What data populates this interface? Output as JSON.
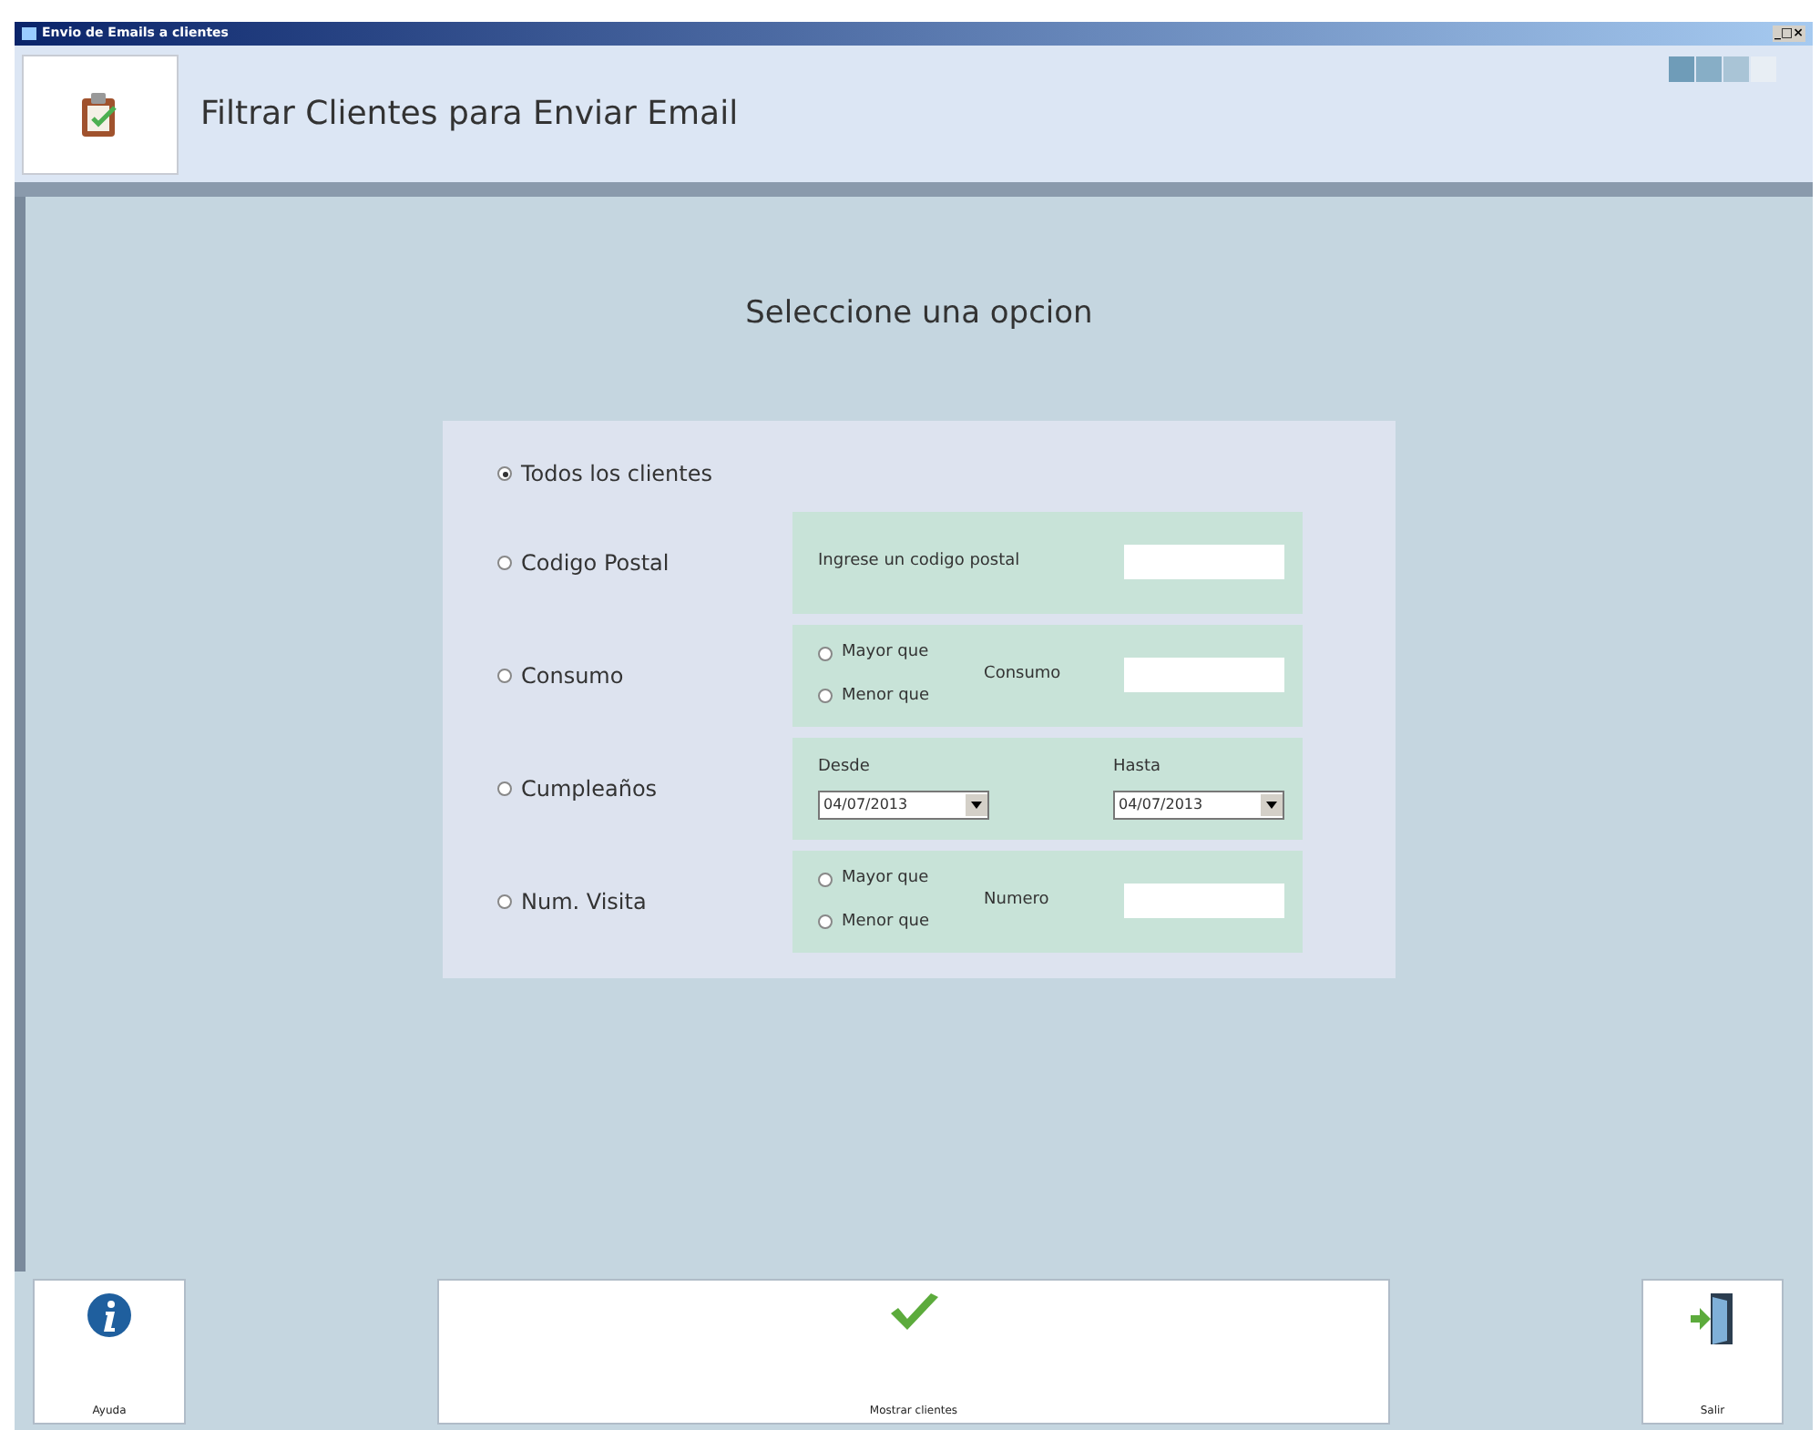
{
  "window": {
    "title": "Envio de Emails a clientes",
    "controls": "_□×"
  },
  "header": {
    "title": "Filtrar Clientes para Enviar Email"
  },
  "heading": "Seleccione una opcion",
  "options": [
    {
      "label": "Todos los clientes",
      "selected": true,
      "kind": "plain"
    },
    {
      "label": "Codigo Postal",
      "selected": false,
      "kind": "text",
      "field_label": "Ingrese un codigo postal"
    },
    {
      "label": "Consumo",
      "selected": false,
      "kind": "compare",
      "choices": [
        {
          "label": "Mayor que",
          "selected": false
        },
        {
          "label": "Menor que",
          "selected": false
        }
      ],
      "field_label": "Consumo"
    },
    {
      "label": "Cumpleaños",
      "selected": false,
      "kind": "dates",
      "dates": [
        {
          "label": "Desde",
          "value": "04/07/2013"
        },
        {
          "label": "Hasta",
          "value": "04/07/2013"
        }
      ]
    },
    {
      "label": "Num. Visita",
      "selected": false,
      "kind": "compare",
      "choices": [
        {
          "label": "Mayor que",
          "selected": false
        },
        {
          "label": "Menor que",
          "selected": false
        }
      ],
      "field_label": "Numero"
    }
  ],
  "buttons": [
    {
      "label": "Ayuda",
      "kind": "help"
    },
    {
      "label": "Mostrar clientes",
      "kind": "ok"
    },
    {
      "label": "Salir",
      "kind": "exit"
    }
  ]
}
